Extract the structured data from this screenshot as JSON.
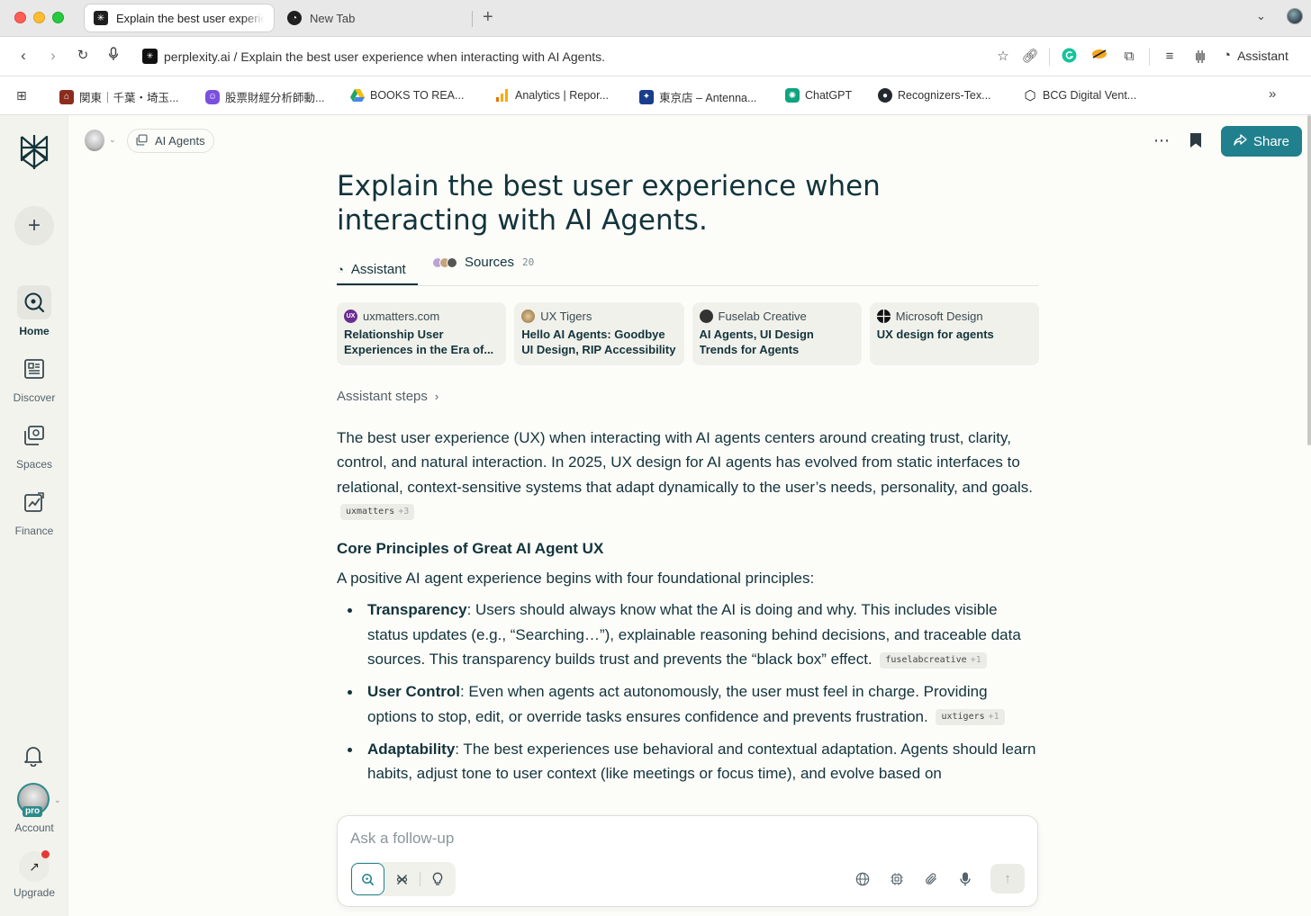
{
  "browser": {
    "tabs": [
      {
        "title": "Explain the best user experie",
        "favicon": "perplexity-logo-icon",
        "active": true
      },
      {
        "title": "New Tab",
        "favicon": "perplexity-assistant-icon",
        "active": false
      }
    ],
    "new_tab_symbol": "+",
    "url": "perplexity.ai / Explain the best user experience when interacting with AI Agents.",
    "assistant_label": "Assistant",
    "bookmarks": [
      {
        "label": "関東｜千葉・埼玉...",
        "color": "#8b2c1f"
      },
      {
        "label": "股票財經分析師動...",
        "color": "#7b4fe0"
      },
      {
        "label": "BOOKS TO REA...",
        "color": "#1fa463"
      },
      {
        "label": "Analytics | Repor...",
        "color": "#f9ab00"
      },
      {
        "label": "東京店 – Antenna...",
        "color": "#1a3c8c"
      },
      {
        "label": "ChatGPT",
        "color": "#10a37f"
      },
      {
        "label": "Recognizers-Tex...",
        "color": "#24292f"
      },
      {
        "label": "BCG Digital Vent...",
        "color": "#222222"
      }
    ]
  },
  "sidebar": {
    "items": [
      {
        "label": "Home",
        "icon": "search-circle-icon",
        "active": true
      },
      {
        "label": "Discover",
        "icon": "newspaper-icon",
        "active": false
      },
      {
        "label": "Spaces",
        "icon": "spaces-icon",
        "active": false
      },
      {
        "label": "Finance",
        "icon": "chart-icon",
        "active": false
      }
    ],
    "account_label": "Account",
    "pro_label": "pro",
    "upgrade_label": "Upgrade"
  },
  "thread": {
    "space_label": "AI Agents",
    "share_label": "Share",
    "title": "Explain the best user experience when interacting with AI Agents.",
    "tab_assistant": "Assistant",
    "tab_sources": "Sources",
    "sources_count": "20",
    "source_cards": [
      {
        "source": "uxmatters.com",
        "title": "Relationship User Experiences in the Era of...",
        "icon_color": "#6b2d8f",
        "icon_text": "UX"
      },
      {
        "source": "UX Tigers",
        "title": "Hello AI Agents: Goodbye UI Design, RIP Accessibility",
        "icon_color": "#b08a5a",
        "icon_text": ""
      },
      {
        "source": "Fuselab Creative",
        "title": "AI Agents, UI Design Trends for Agents",
        "icon_color": "#333333",
        "icon_text": ""
      },
      {
        "source": "Microsoft Design",
        "title": "UX design for agents",
        "icon_color": "#111111",
        "icon_text": ""
      }
    ],
    "steps_label": "Assistant steps"
  },
  "answer": {
    "intro": "The best user experience (UX) when interacting with AI agents centers around creating trust, clarity, control, and natural interaction. In 2025, UX design for AI agents has evolved from static interfaces to relational, context-sensitive systems that adapt dynamically to the user’s needs, personality, and goals.",
    "intro_cite": {
      "name": "uxmatters",
      "extra": "+3"
    },
    "heading": "Core Principles of Great AI Agent UX",
    "lead": "A positive AI agent experience begins with four foundational principles:",
    "bullets": [
      {
        "term": "Transparency",
        "text": ": Users should always know what the AI is doing and why. This includes visible status updates (e.g., “Searching…”), explainable reasoning behind decisions, and traceable data sources. This transparency builds trust and prevents the “black box” effect.",
        "cite_name": "fuselabcreative",
        "cite_extra": "+1"
      },
      {
        "term": "User Control",
        "text": ": Even when agents act autonomously, the user must feel in charge. Providing options to stop, edit, or override tasks ensures confidence and prevents frustration.",
        "cite_name": "uxtigers",
        "cite_extra": "+1"
      },
      {
        "term": "Adaptability",
        "text": ": The best experiences use behavioral and contextual adaptation. Agents should learn habits, adjust tone to user context (like meetings or focus time), and evolve based on",
        "cite_name": "",
        "cite_extra": ""
      }
    ]
  },
  "followup": {
    "placeholder": "Ask a follow-up"
  },
  "colors": {
    "accent": "#21808d",
    "text": "#13343b",
    "background": "#fcfcf9"
  }
}
